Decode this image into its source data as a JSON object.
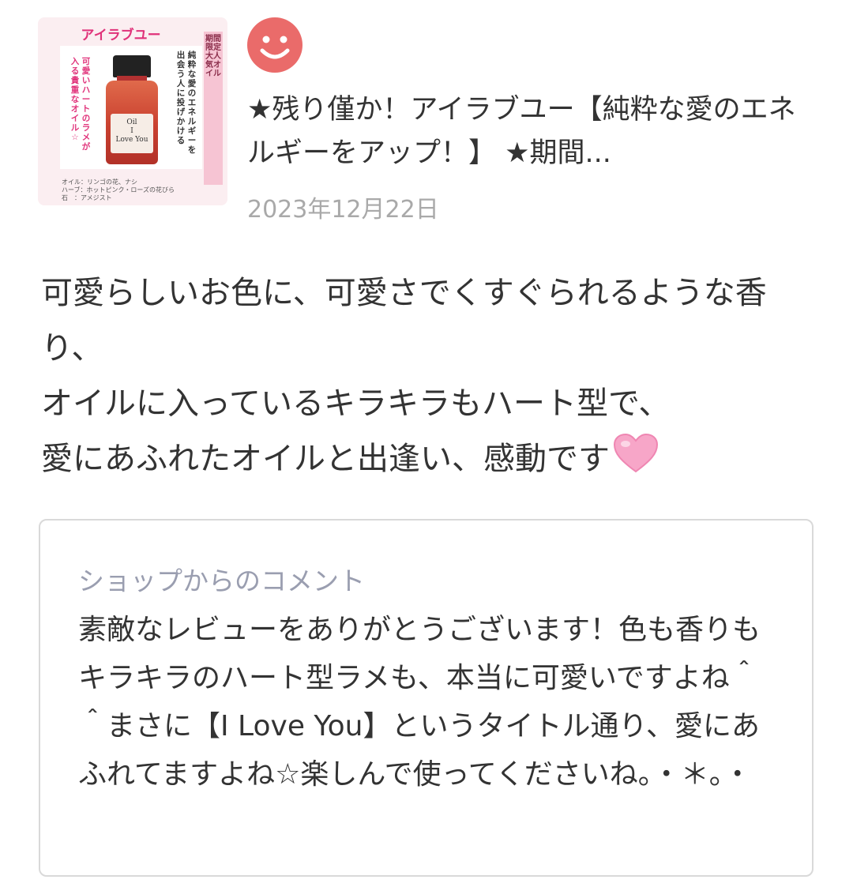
{
  "product": {
    "thumbnail": {
      "title": "アイラブユー",
      "band_text": "期間限定 大人気オイル",
      "tagline_pink_1": "可愛いハートのラメが",
      "tagline_pink_2": "入る貴重なオイル☆",
      "tagline_dark_1": "純粋な愛のエネルギーを",
      "tagline_dark_2": "出会う人に投げかける",
      "bottle_label_1": "Oil",
      "bottle_label_2": "I",
      "bottle_label_3": "Love You",
      "foot_1": "オイル：リンゴの花、ナシ",
      "foot_2": "ハーブ：ホットピンク・ローズの花びら",
      "foot_3": "石　：アメジスト"
    },
    "title": "★残り僅か！アイラブユー【純粋な愛のエネルギーをアップ！】 ★期間...",
    "date": "2023年12月22日"
  },
  "reviewer": {
    "avatar_icon": "smiley-face-icon",
    "avatar_color": "#ea6b6a"
  },
  "review": {
    "text": "可愛らしいお色に、可愛さでくすぐられるような香り、\nオイルに入っているキラキラもハート型で、\n愛にあふれたオイルと出逢い、感動です",
    "emoji": "pink-heart-emoji"
  },
  "shop_comment": {
    "label": "ショップからのコメント",
    "text": "素敵なレビューをありがとうございます！色も香りもキラキラのハート型ラメも、本当に可愛いですよね＾＾まさに【I Love You】というタイトル通り、愛にあふれてますよね☆楽しんで使ってくださいね。・＊。・"
  },
  "colors": {
    "accent_pink": "#e0327a",
    "muted_label": "#9a9eb0",
    "date_gray": "#a9a9a9",
    "border": "#d9d9d9"
  }
}
